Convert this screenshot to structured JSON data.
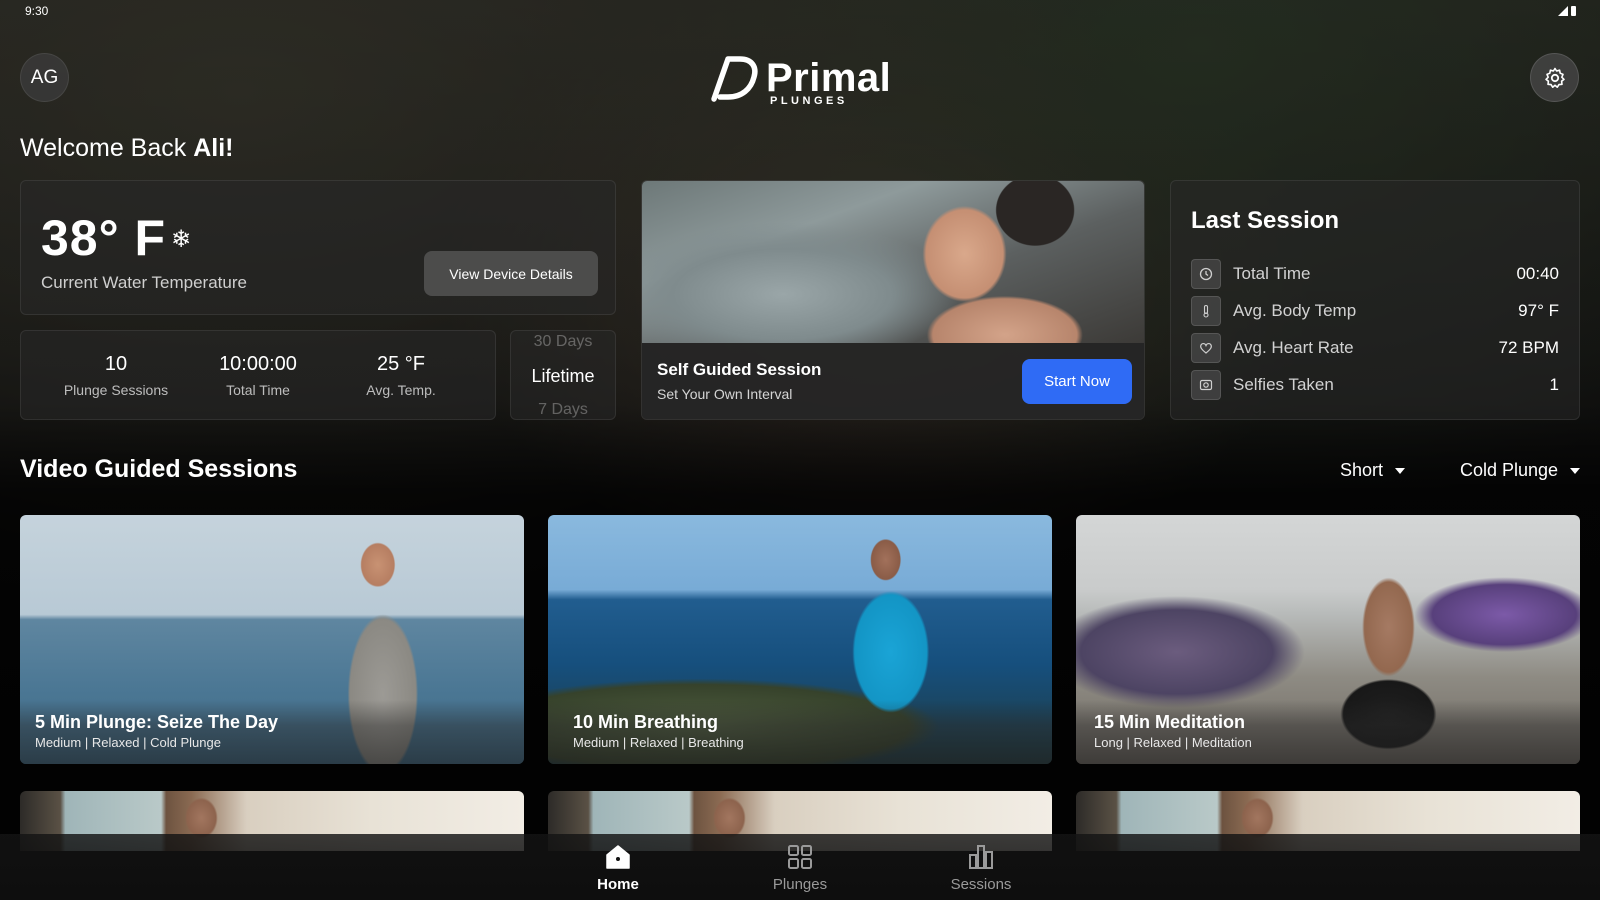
{
  "status_bar": {
    "time": "9:30"
  },
  "header": {
    "avatar_initials": "AG",
    "logo_word": "Primal",
    "logo_sub": "PLUNGES",
    "settings_icon": "gear-icon"
  },
  "welcome": {
    "prefix": "Welcome Back",
    "name": "Ali!"
  },
  "water": {
    "temperature": "38° F",
    "label": "Current Water Temperature",
    "device_button": "View Device Details",
    "icon": "snowflake-icon"
  },
  "stats": [
    {
      "value": "10",
      "label": "Plunge Sessions"
    },
    {
      "value": "10:00:00",
      "label": "Total Time"
    },
    {
      "value": "25 °F",
      "label": "Avg. Temp."
    }
  ],
  "range_picker": {
    "above": "30 Days",
    "selected": "Lifetime",
    "below": "7 Days"
  },
  "self_guided": {
    "title": "Self Guided Session",
    "subtitle": "Set Your Own Interval",
    "button": "Start Now",
    "accent": "#2f6bf5"
  },
  "last_session": {
    "title": "Last Session",
    "rows": [
      {
        "icon": "clock-icon",
        "label": "Total Time",
        "value": "00:40"
      },
      {
        "icon": "thermometer-icon",
        "label": "Avg. Body Temp",
        "value": "97°  F"
      },
      {
        "icon": "heart-icon",
        "label": "Avg. Heart Rate",
        "value": "72 BPM"
      },
      {
        "icon": "camera-icon",
        "label": "Selfies Taken",
        "value": "1"
      }
    ]
  },
  "video_section": {
    "title": "Video Guided Sessions",
    "filter_length": "Short",
    "filter_type": "Cold Plunge",
    "videos": [
      {
        "title": "5 Min Plunge: Seize The Day",
        "tags": "Medium  |  Relaxed  |  Cold Plunge"
      },
      {
        "title": "10 Min Breathing",
        "tags": "Medium  |  Relaxed  |  Breathing"
      },
      {
        "title": "15 Min Meditation",
        "tags": "Long  |  Relaxed  |  Meditation"
      }
    ]
  },
  "bottom_nav": [
    {
      "label": "Home",
      "icon": "home-icon",
      "active": true
    },
    {
      "label": "Plunges",
      "icon": "grid-icon",
      "active": false
    },
    {
      "label": "Sessions",
      "icon": "bar-chart-icon",
      "active": false
    }
  ]
}
